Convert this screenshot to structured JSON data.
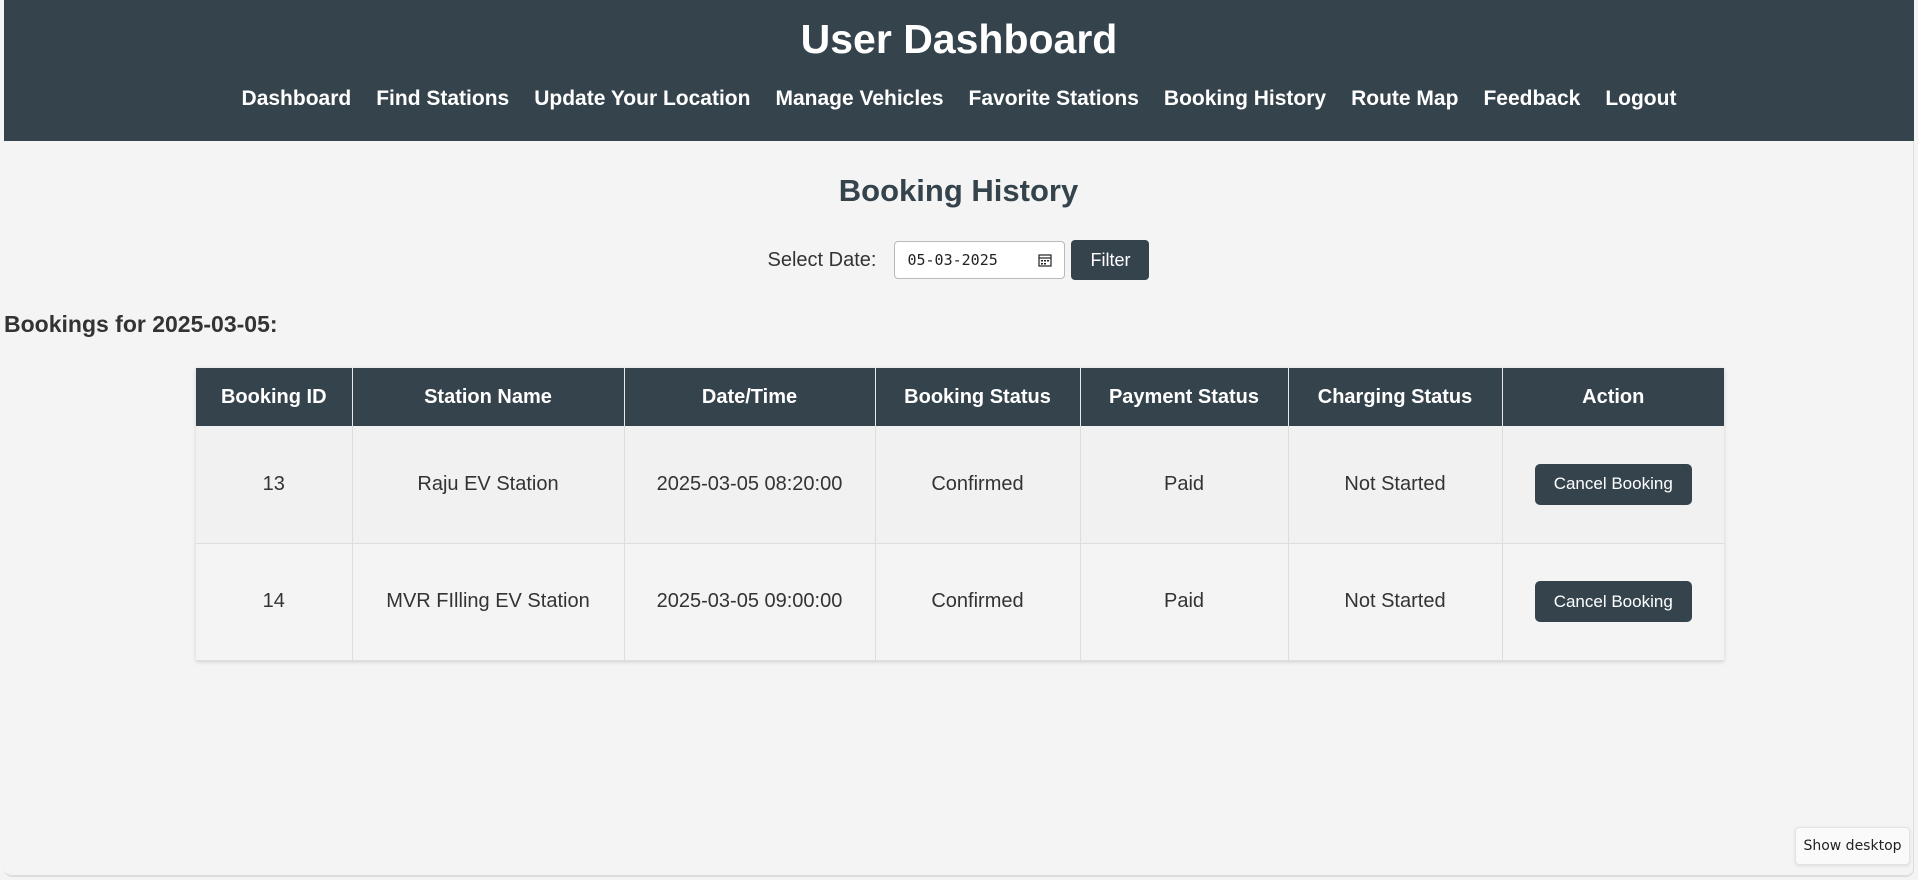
{
  "header": {
    "title": "User Dashboard",
    "nav": [
      "Dashboard",
      "Find Stations",
      "Update Your Location",
      "Manage Vehicles",
      "Favorite Stations",
      "Booking History",
      "Route Map",
      "Feedback",
      "Logout"
    ]
  },
  "main": {
    "heading": "Booking History",
    "filter": {
      "label": "Select Date:",
      "date_value": "05-03-2025",
      "button_label": "Filter"
    },
    "bookings_heading": "Bookings for 2025-03-05:",
    "table": {
      "headers": [
        "Booking ID",
        "Station Name",
        "Date/Time",
        "Booking Status",
        "Payment Status",
        "Charging Status",
        "Action"
      ],
      "rows": [
        {
          "id": "13",
          "station": "Raju EV Station",
          "datetime": "2025-03-05 08:20:00",
          "booking_status": "Confirmed",
          "payment_status": "Paid",
          "charging_status": "Not Started",
          "action": "Cancel Booking"
        },
        {
          "id": "14",
          "station": "MVR FIlling EV Station",
          "datetime": "2025-03-05 09:00:00",
          "booking_status": "Confirmed",
          "payment_status": "Paid",
          "charging_status": "Not Started",
          "action": "Cancel Booking"
        }
      ]
    }
  },
  "taskbar": {
    "show_desktop_label": "Show desktop"
  },
  "colors": {
    "header_bg": "#35434c",
    "page_bg": "#f4f4f4"
  }
}
